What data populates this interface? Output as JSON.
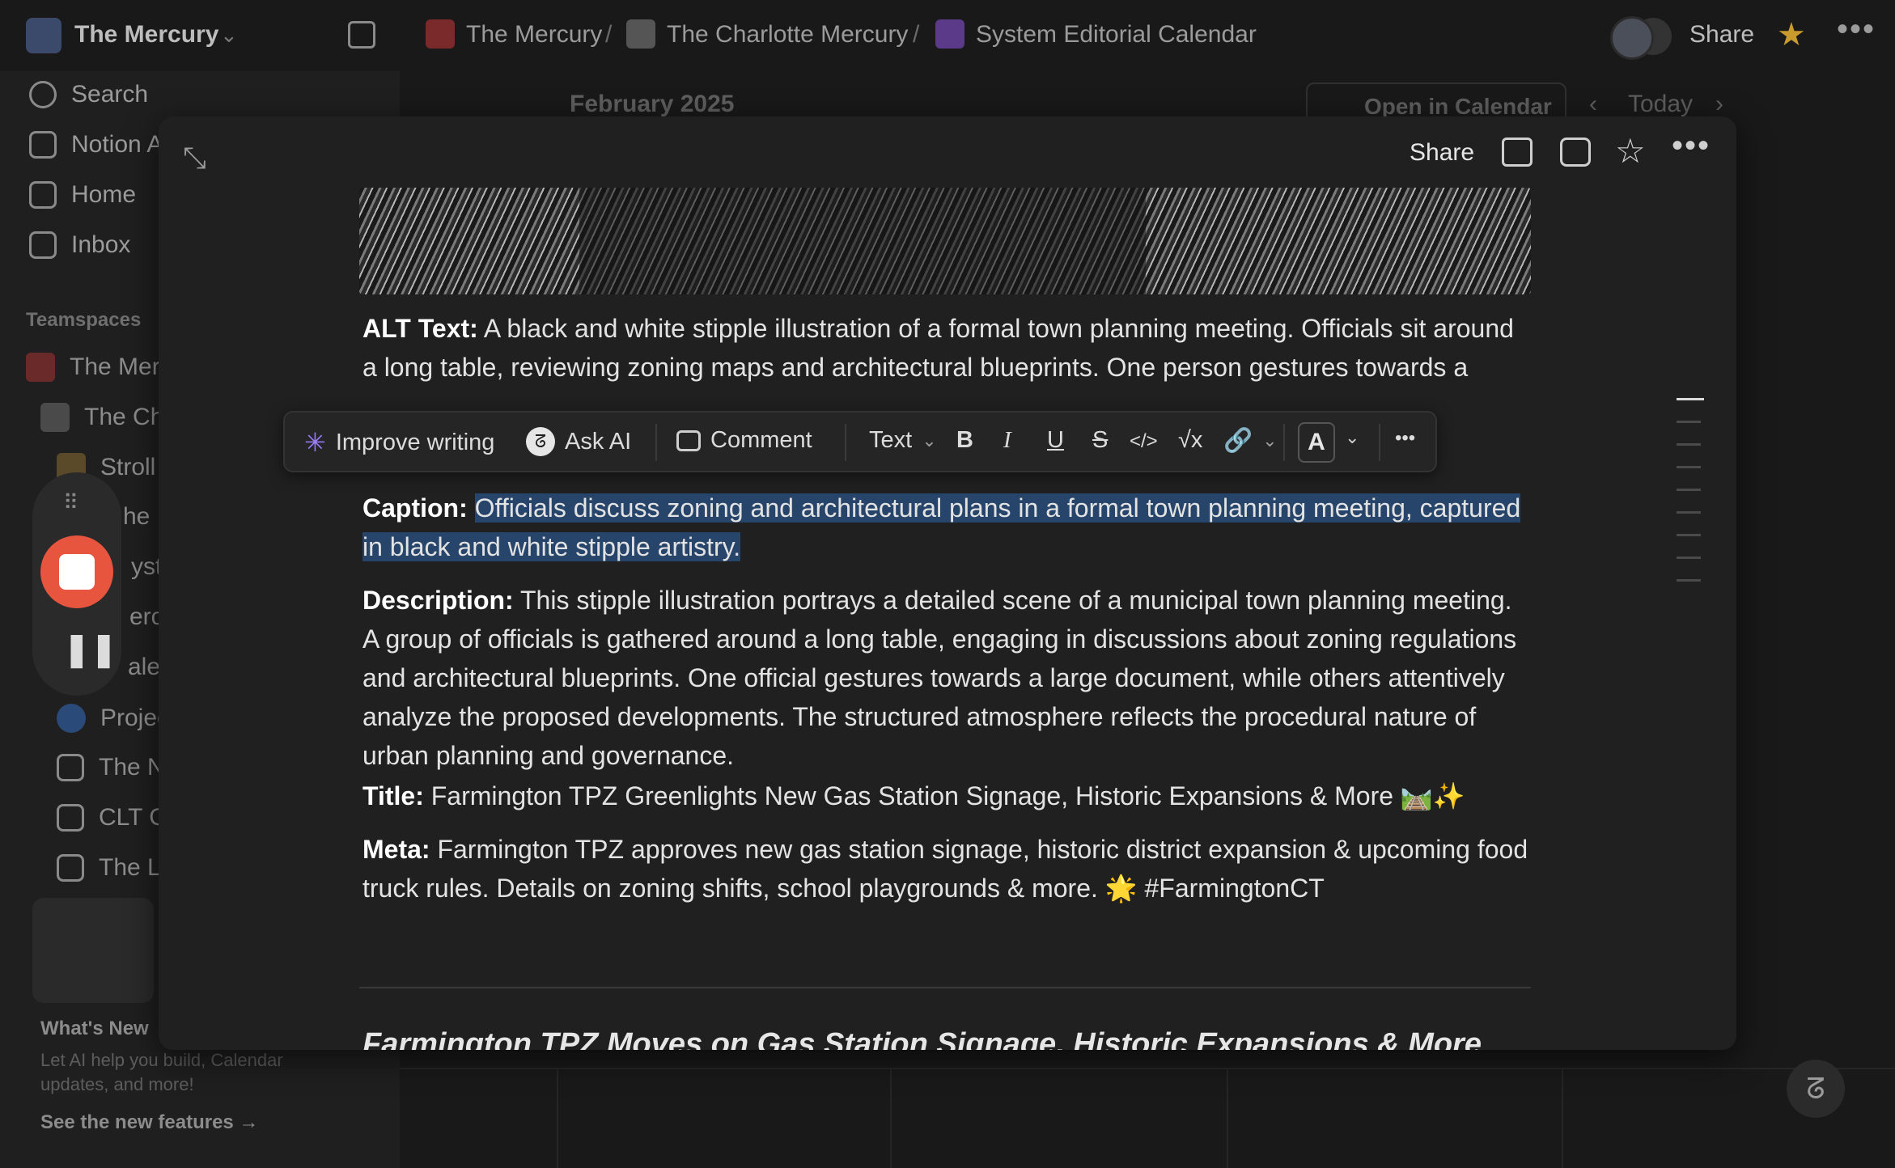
{
  "topbar": {
    "workspace_name": "The Mercury",
    "breadcrumbs": [
      "The Mercury",
      "The Charlotte Mercury",
      "System Editorial Calendar"
    ],
    "share_label": "Share"
  },
  "sidebar": {
    "items": [
      "Search",
      "Notion A",
      "Home",
      "Inbox"
    ],
    "section_label": "Teamspaces",
    "teams": [
      "The Mer",
      "The Ch",
      "Stroll",
      "he F",
      "yste",
      "ercu",
      "ales",
      "Projec",
      "The N",
      "CLT G",
      "The L"
    ],
    "whats_new": {
      "title": "What's New",
      "desc": "Let AI help you build, Calendar updates, and more!",
      "link": "See the new features"
    }
  },
  "calendar": {
    "month": "February 2025",
    "open_label": "Open in Calendar",
    "today_label": "Today"
  },
  "modal": {
    "share_label": "Share",
    "alt": {
      "label": "ALT Text:",
      "text": "A black and white stipple illustration of a formal town planning meeting. Officials sit around a long table, reviewing zoning maps and architectural blueprints. One person gestures towards a large document while others listen attentively in a structured municipal setting."
    },
    "caption": {
      "label": "Caption:",
      "text": "Officials discuss zoning and architectural plans in a formal town planning meeting, captured in black and white stipple artistry."
    },
    "description": {
      "label": "Description:",
      "text": "This stipple illustration portrays a detailed scene of a municipal town planning meeting. A group of officials is gathered around a long table, engaging in discussions about zoning regulations and architectural blueprints. One official gestures towards a large document, while others attentively analyze the proposed developments. The structured atmosphere reflects the procedural nature of urban planning and governance."
    },
    "title": {
      "label": "Title:",
      "text": "Farmington TPZ Greenlights New Gas Station Signage, Historic Expansions & More 🛤️✨"
    },
    "meta": {
      "label": "Meta:",
      "text": "Farmington TPZ approves new gas station signage, historic district expansion & upcoming food truck rules. Details on zoning shifts, school playgrounds & more. 🌟 #FarmingtonCT"
    },
    "heading": "Farmington TPZ Moves on Gas Station Signage, Historic Expansions & More"
  },
  "toolbar": {
    "improve": "Improve writing",
    "ask_ai": "Ask AI",
    "comment": "Comment",
    "text": "Text",
    "bold": "B",
    "italic": "I",
    "underline": "U",
    "strike": "S",
    "code": "</>",
    "math": "√x",
    "link": "🔗",
    "color": "A",
    "more": "•••"
  }
}
